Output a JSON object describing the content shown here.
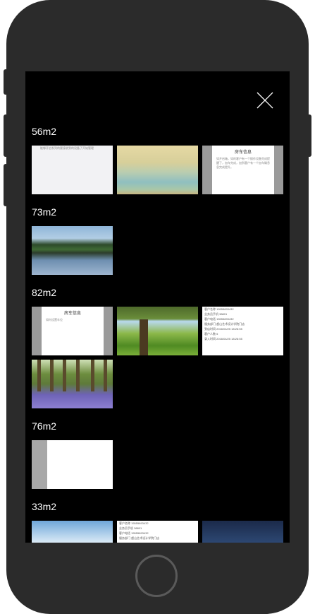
{
  "close_icon": "close-icon",
  "groups": [
    {
      "title": "56m2",
      "thumbs": [
        {
          "kind": "light",
          "text": "能够开启系列的要接收到的设备了开始管理"
        },
        {
          "kind": "paint"
        },
        {
          "kind": "dialog",
          "title": "房车信息",
          "body": "如开启箱，如的客户有一个操作设备完成提醒了，加车完成，加到客户有一个加车确息息完成提升。"
        }
      ]
    },
    {
      "title": "73m2",
      "thumbs": [
        {
          "kind": "lake"
        }
      ]
    },
    {
      "title": "82m2",
      "thumbs": [
        {
          "kind": "dialog",
          "title": "房车信息",
          "body": "如何设置车位"
        },
        {
          "kind": "tree"
        },
        {
          "kind": "form",
          "rows": [
            "客户名称 15555893432",
            "业务员手机 38801",
            "客户电话 15555893432",
            "服务部门 超山艺术设计学院门店",
            "到店时间 2016/04/25 18:26:55",
            "客户人数 5",
            "录入时间 2016/04/25 18:26:55"
          ]
        },
        {
          "kind": "forest"
        }
      ]
    },
    {
      "title": "76m2",
      "thumbs": [
        {
          "kind": "half"
        }
      ]
    },
    {
      "title": "33m2",
      "thumbs": [
        {
          "kind": "sky"
        },
        {
          "kind": "form",
          "rows": [
            "客户名称 15555893432",
            "业务员手机 38801",
            "客户电话 15555893432",
            "服务部门 超山艺术设计学院门店"
          ]
        },
        {
          "kind": "stars"
        }
      ]
    }
  ]
}
